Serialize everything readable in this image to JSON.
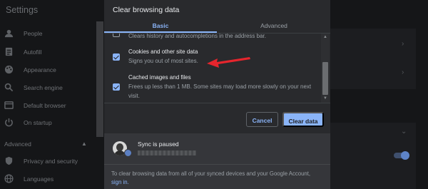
{
  "settings": {
    "title": "Settings",
    "sidebar": [
      {
        "label": "People",
        "icon": "person-icon"
      },
      {
        "label": "Autofill",
        "icon": "autofill-icon"
      },
      {
        "label": "Appearance",
        "icon": "palette-icon"
      },
      {
        "label": "Search engine",
        "icon": "search-icon"
      },
      {
        "label": "Default browser",
        "icon": "browser-icon"
      },
      {
        "label": "On startup",
        "icon": "power-icon"
      }
    ],
    "advanced_label": "Advanced",
    "advanced_items": [
      {
        "label": "Privacy and security",
        "icon": "shield-icon"
      },
      {
        "label": "Languages",
        "icon": "globe-icon"
      }
    ]
  },
  "dialog": {
    "title": "Clear browsing data",
    "tabs": [
      {
        "label": "Basic",
        "active": true
      },
      {
        "label": "Advanced",
        "active": false
      }
    ],
    "items": [
      {
        "title": "",
        "description": "Clears history and autocompletions in the address bar.",
        "checked": false
      },
      {
        "title": "Cookies and other site data",
        "description": "Signs you out of most sites.",
        "checked": true
      },
      {
        "title": "Cached images and files",
        "description": "Frees up less than 1 MB. Some sites may load more slowly on your next",
        "description_cont": "visit.",
        "checked": true
      }
    ],
    "cancel_label": "Cancel",
    "clear_label": "Clear data",
    "sync": {
      "title": "Sync is paused",
      "footer_text": "To clear browsing data from all of your synced devices and your Google Account,",
      "sign_in_label": "sign in."
    }
  },
  "colors": {
    "accent": "#8ab4f8",
    "annotation_arrow": "#e5252d",
    "dialog_bg": "#292a2d",
    "page_bg": "#151618"
  }
}
